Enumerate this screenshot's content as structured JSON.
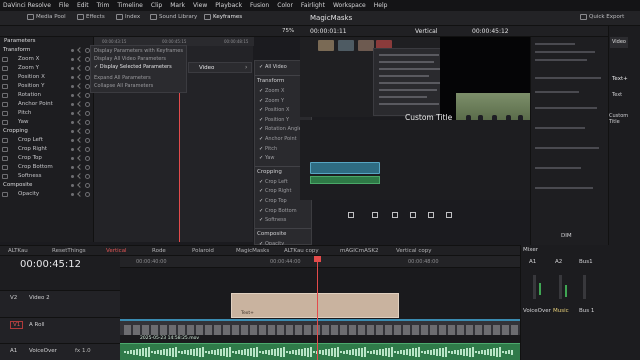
{
  "menubar": {
    "app_name": "DaVinci Resolve",
    "items": [
      "File",
      "Edit",
      "Trim",
      "Timeline",
      "Clip",
      "Mark",
      "View",
      "Playback",
      "Fusion",
      "Color",
      "Fairlight",
      "Workspace",
      "Help"
    ]
  },
  "toolbar": {
    "media_pool": "Media Pool",
    "effects": "Effects",
    "index": "Index",
    "sound_library": "Sound Library",
    "keyframes": "Keyframes",
    "project_title": "MagicMasks",
    "quick_export": "Quick Export"
  },
  "subbar": {
    "zoom": "75%",
    "source_timecode": "00:00:01:11",
    "timeline_name": "Vertical",
    "record_timecode": "00:00:45:12"
  },
  "parameters": {
    "header": "Parameters",
    "rows": [
      {
        "label": "Transform"
      },
      {
        "label": "Zoom X"
      },
      {
        "label": "Zoom Y"
      },
      {
        "label": "Position X"
      },
      {
        "label": "Position Y"
      },
      {
        "label": "Rotation"
      },
      {
        "label": "Anchor Point"
      },
      {
        "label": "Pitch"
      },
      {
        "label": "Yaw"
      },
      {
        "label": "Cropping"
      },
      {
        "label": "Crop Left"
      },
      {
        "label": "Crop Right"
      },
      {
        "label": "Crop Top"
      },
      {
        "label": "Crop Bottom"
      },
      {
        "label": "Softness"
      },
      {
        "label": "Composite"
      },
      {
        "label": "Opacity"
      }
    ]
  },
  "keyframe_ruler": [
    "00:00:43:15",
    "00:00:45:15",
    "00:00:48:15"
  ],
  "context_menu": {
    "items": [
      "Display Parameters with Keyframes",
      "Display All Video Parameters",
      "Display Selected Parameters",
      "Expand All Parameters",
      "Collapse All Parameters"
    ],
    "submenu_label": "Video"
  },
  "param_checklist": {
    "all_video": "All Video",
    "sections": [
      {
        "header": "Transform",
        "items": [
          "Zoom X",
          "Zoom Y",
          "Position X",
          "Position Y",
          "Rotation Angle",
          "Anchor Point",
          "Pitch",
          "Yaw"
        ]
      },
      {
        "header": "Cropping",
        "items": [
          "Crop Left",
          "Crop Right",
          "Crop Top",
          "Crop Bottom",
          "Softness"
        ]
      },
      {
        "header": "Composite",
        "items": [
          "Opacity"
        ]
      }
    ]
  },
  "viewer": {
    "overlay_title": "Custom Title"
  },
  "right_panel": {
    "tab_video": "Video",
    "text_plus": "Text+",
    "text_label": "Text",
    "custom_title": "Custom Title"
  },
  "timeline_tabs": [
    "ALTKau",
    "ResetThings",
    "Vertical",
    "Rode",
    "Polaroid",
    "MagicMasks",
    "ALTKau copy",
    "mAGICmASK2",
    "Vertical copy"
  ],
  "timeline": {
    "timecode": "00:00:45:12",
    "ruler": [
      "00:00:40:00",
      "00:00:44:00",
      "00:00:48:00"
    ],
    "tracks": [
      {
        "id": "V2",
        "name": "Video 2"
      },
      {
        "id": "V1",
        "name": "A Roll"
      },
      {
        "id": "A1",
        "name": "VoiceOver",
        "level": "fx 1.0"
      }
    ],
    "title_clip": "Text+",
    "aroll_clip": "2025-05-23 14:58:25.mov"
  },
  "mixer": {
    "title": "Mixer",
    "channels": [
      "A1",
      "A2",
      "Bus1"
    ],
    "bottom_labels": [
      "VoiceOver",
      "Music",
      "Bus 1"
    ],
    "dim": "DIM"
  }
}
